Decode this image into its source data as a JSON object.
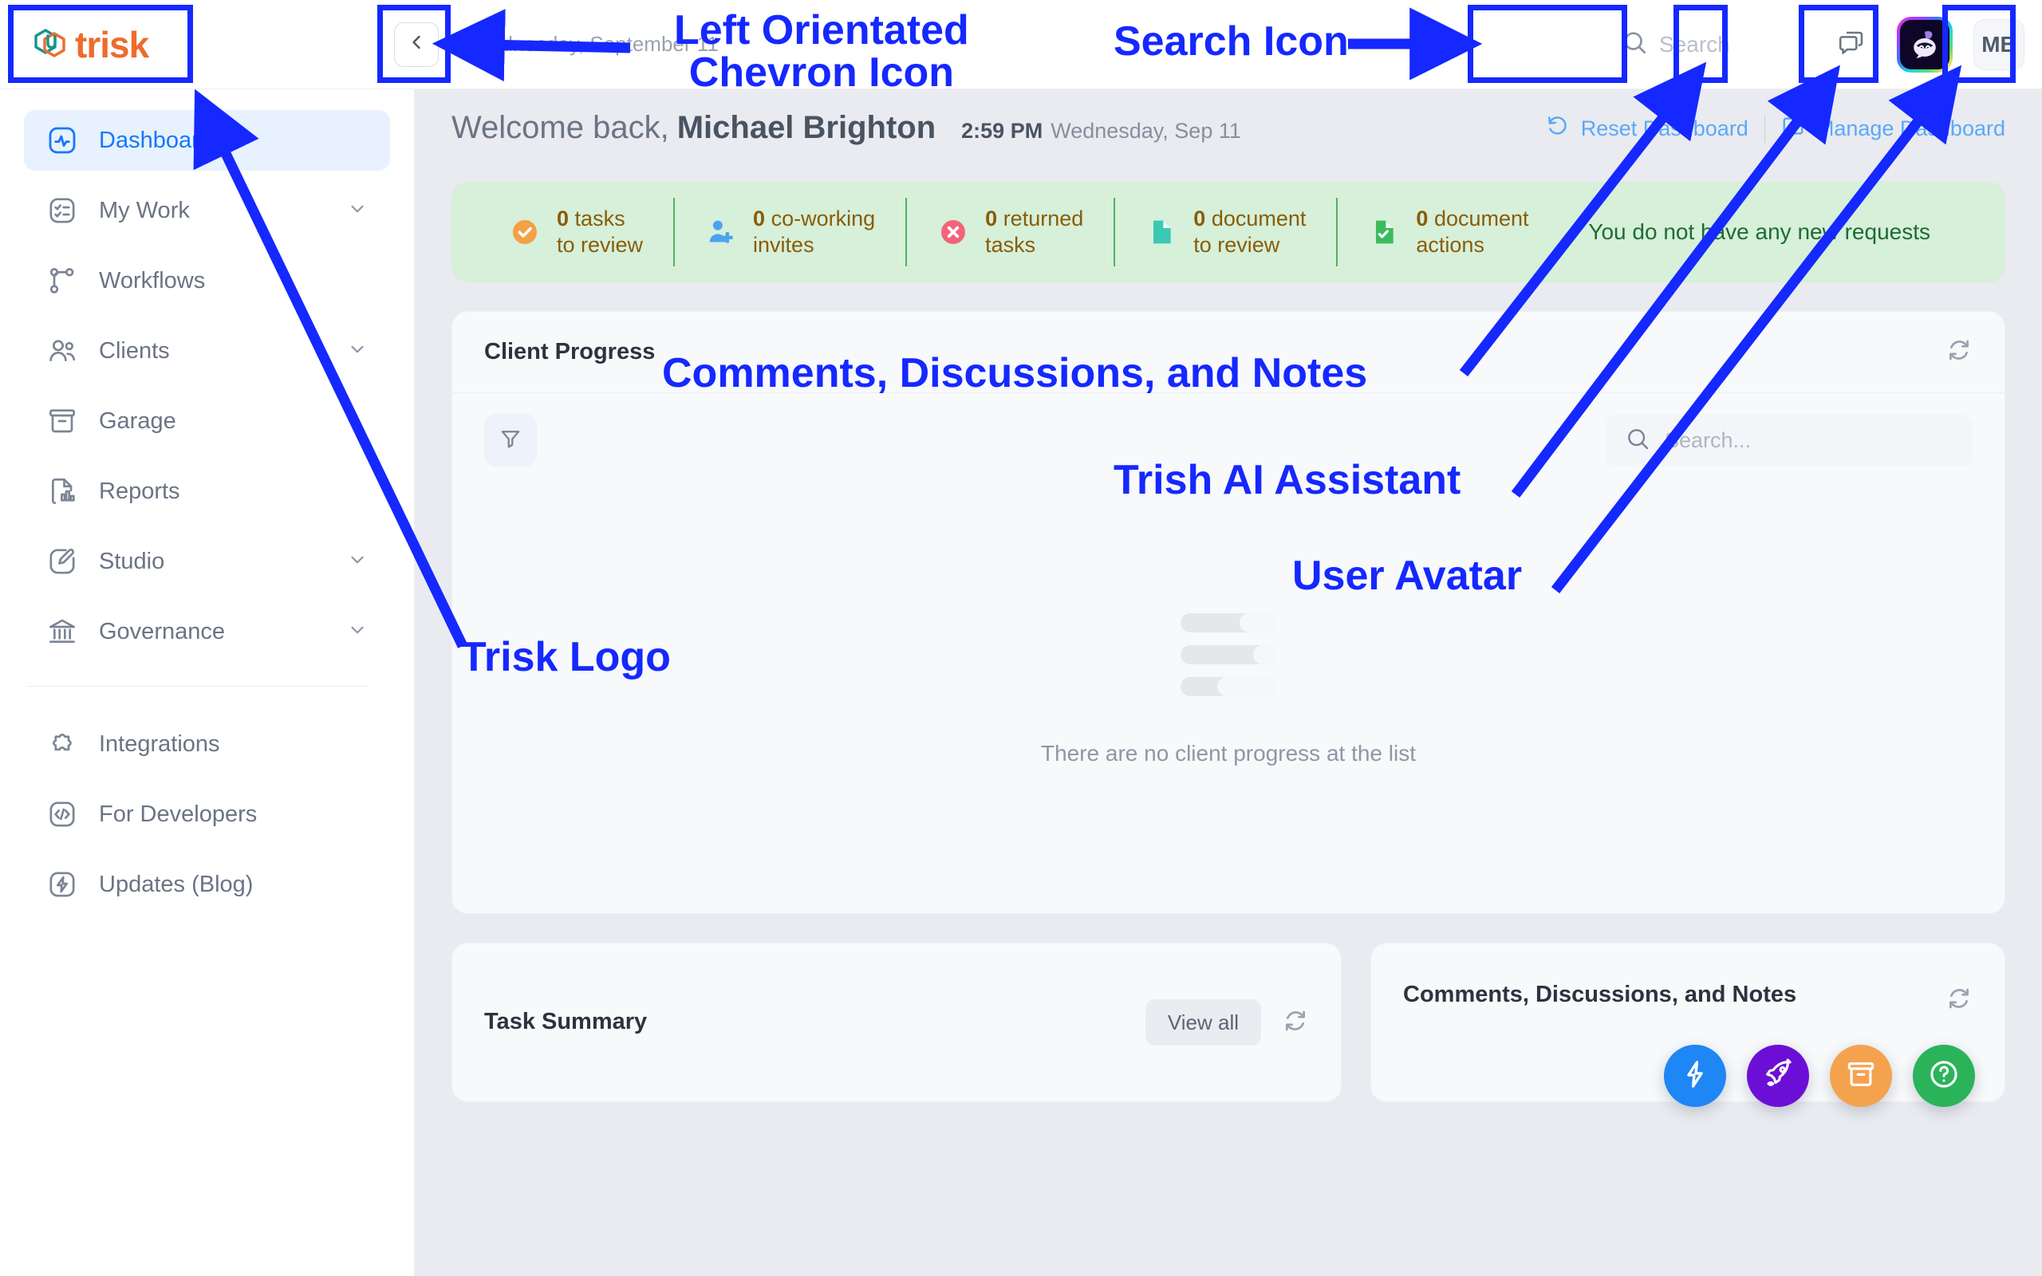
{
  "app": {
    "logo_text": "trisk",
    "brand_orange": "#ed6c2d",
    "brand_teal": "#16958c"
  },
  "topbar": {
    "collapse_icon": "chevron-left-icon",
    "date_text": "Wednesday, September 11",
    "search_placeholder": "Search",
    "comments_icon": "comments-icon",
    "trish_icon": "trish-ai-icon",
    "avatar_initials": "MB"
  },
  "sidebar": {
    "items": [
      {
        "label": "Dashboard",
        "icon": "dashboard-pulse-icon",
        "active": true,
        "chevron": false
      },
      {
        "label": "My Work",
        "icon": "checklist-icon",
        "active": false,
        "chevron": true
      },
      {
        "label": "Workflows",
        "icon": "workflow-branch-icon",
        "active": false,
        "chevron": false
      },
      {
        "label": "Clients",
        "icon": "users-icon",
        "active": false,
        "chevron": true
      },
      {
        "label": "Garage",
        "icon": "archive-box-icon",
        "active": false,
        "chevron": false
      },
      {
        "label": "Reports",
        "icon": "report-chart-icon",
        "active": false,
        "chevron": false
      },
      {
        "label": "Studio",
        "icon": "paintbrush-icon",
        "active": false,
        "chevron": true
      },
      {
        "label": "Governance",
        "icon": "bank-columns-icon",
        "active": false,
        "chevron": true
      }
    ],
    "secondary_items": [
      {
        "label": "Integrations",
        "icon": "puzzle-piece-icon"
      },
      {
        "label": "For Developers",
        "icon": "code-brackets-icon"
      },
      {
        "label": "Updates (Blog)",
        "icon": "lightning-bolt-icon"
      }
    ]
  },
  "main": {
    "welcome_prefix": "Welcome back,",
    "user_name": "Michael Brighton",
    "time": "2:59 PM",
    "date": "Wednesday, Sep 11",
    "reset_dashboard": "Reset Dashboard",
    "manage_dashboard": "Manage Dashboard",
    "stats": [
      {
        "count": "0",
        "line1": "tasks",
        "line2": "to review",
        "icon": "check-circle-icon",
        "color": "#f5a045"
      },
      {
        "count": "0",
        "line1": "co-working",
        "line2": "invites",
        "icon": "user-plus-icon",
        "color": "#4aa3f0"
      },
      {
        "count": "0",
        "line1": "returned",
        "line2": "tasks",
        "icon": "x-circle-icon",
        "color": "#f2647a"
      },
      {
        "count": "0",
        "line1": "document",
        "line2": "to review",
        "icon": "document-icon",
        "color": "#3cc8b4"
      },
      {
        "count": "0",
        "line1": "document",
        "line2": "actions",
        "icon": "document-check-icon",
        "color": "#3cbb5e"
      }
    ],
    "stats_note": "You do not have any new requests",
    "client_progress": {
      "title": "Client Progress",
      "refresh_icon": "refresh-icon",
      "filter_icon": "funnel-filter-icon",
      "search_placeholder": "Search...",
      "empty_text": "There are no client progress at the list",
      "skeleton_fills": [
        62,
        76,
        38
      ]
    },
    "task_summary": {
      "title": "Task Summary",
      "view_all": "View all",
      "refresh_icon": "refresh-icon"
    },
    "comments_card": {
      "title": "Comments, Discussions, and Notes",
      "refresh_icon": "refresh-icon"
    }
  },
  "fabs": [
    {
      "name": "quick-action-fab",
      "icon": "lightning-bolt-icon",
      "color": "#1f86f5"
    },
    {
      "name": "launch-fab",
      "icon": "rocket-icon",
      "color": "#6c0fd6"
    },
    {
      "name": "garage-fab",
      "icon": "archive-box-icon",
      "color": "#f5a24f"
    },
    {
      "name": "help-fab",
      "icon": "question-circle-icon",
      "color": "#2bb35a"
    }
  ],
  "annotations": {
    "color": "#1528ff",
    "labels": [
      {
        "id": "left-chevron",
        "text": "Left Orientated\nChevron Icon"
      },
      {
        "id": "search-icon",
        "text": "Search Icon"
      },
      {
        "id": "comments",
        "text": "Comments, Discussions, and Notes"
      },
      {
        "id": "trish",
        "text": "Trish AI Assistant"
      },
      {
        "id": "avatar",
        "text": "User Avatar"
      },
      {
        "id": "logo",
        "text": "Trisk Logo"
      }
    ]
  }
}
